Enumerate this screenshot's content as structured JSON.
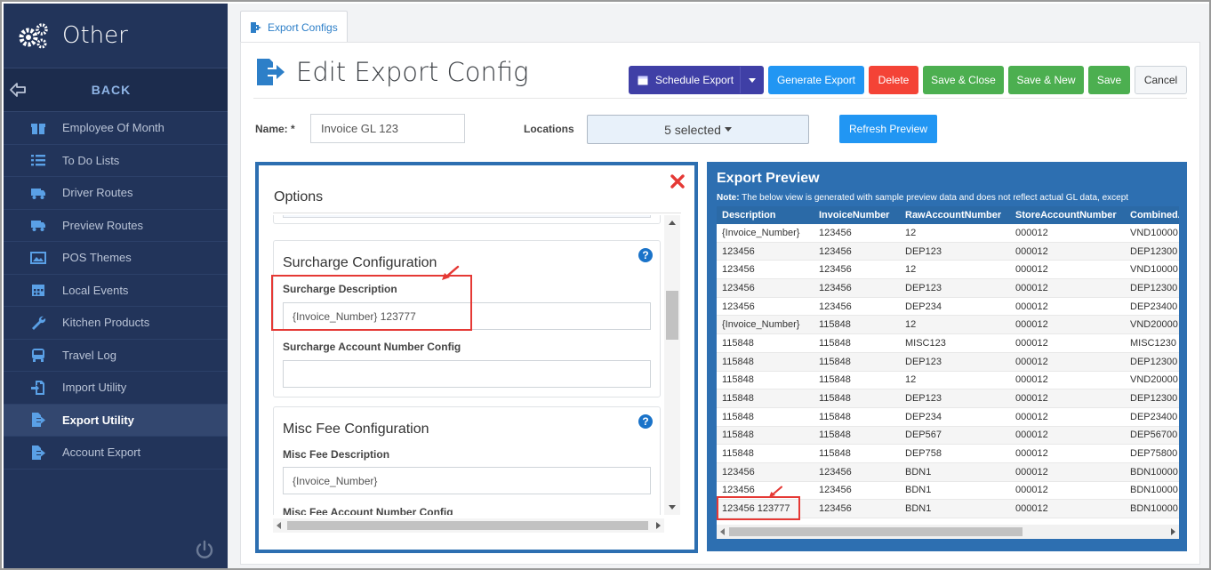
{
  "sidebar": {
    "title": "Other",
    "back_label": "BACK",
    "items": [
      {
        "label": "Employee Of Month",
        "icon": "gift-icon"
      },
      {
        "label": "To Do Lists",
        "icon": "list-icon"
      },
      {
        "label": "Driver Routes",
        "icon": "truck-icon"
      },
      {
        "label": "Preview Routes",
        "icon": "truck-icon"
      },
      {
        "label": "POS Themes",
        "icon": "image-icon"
      },
      {
        "label": "Local Events",
        "icon": "calendar-icon"
      },
      {
        "label": "Kitchen Products",
        "icon": "wrench-icon"
      },
      {
        "label": "Travel Log",
        "icon": "bus-icon"
      },
      {
        "label": "Import Utility",
        "icon": "import-icon"
      },
      {
        "label": "Export Utility",
        "icon": "export-icon",
        "active": true
      },
      {
        "label": "Account Export",
        "icon": "export-icon"
      }
    ]
  },
  "tab": {
    "label": "Export Configs"
  },
  "header": {
    "title": "Edit Export Config",
    "buttons": {
      "schedule": "Schedule Export",
      "generate": "Generate Export",
      "delete": "Delete",
      "save_close": "Save & Close",
      "save_new": "Save & New",
      "save": "Save",
      "cancel": "Cancel"
    }
  },
  "form": {
    "name_label": "Name: *",
    "name_value": "Invoice GL 123",
    "locations_label": "Locations",
    "locations_value": "5 selected",
    "refresh_label": "Refresh Preview"
  },
  "options": {
    "title": "Options",
    "surcharge": {
      "title": "Surcharge Configuration",
      "desc_label": "Surcharge Description",
      "desc_value": "{Invoice_Number} 123777",
      "acct_label": "Surcharge Account Number Config",
      "acct_value": ""
    },
    "misc": {
      "title": "Misc Fee Configuration",
      "desc_label": "Misc Fee Description",
      "desc_value": "{Invoice_Number}",
      "acct_label": "Misc Fee Account Number Config"
    }
  },
  "preview": {
    "title": "Export Preview",
    "note_prefix": "Note:",
    "note_text": " The below view is generated with sample preview data and does not reflect actual GL data, except",
    "columns": [
      "Description",
      "InvoiceNumber",
      "RawAccountNumber",
      "StoreAccountNumber",
      "CombinedA"
    ],
    "rows": [
      [
        "{Invoice_Number}",
        "123456",
        "12",
        "000012",
        "VND10000"
      ],
      [
        "123456",
        "123456",
        "DEP123",
        "000012",
        "DEP12300"
      ],
      [
        "123456",
        "123456",
        "12",
        "000012",
        "VND10000"
      ],
      [
        "123456",
        "123456",
        "DEP123",
        "000012",
        "DEP12300"
      ],
      [
        "123456",
        "123456",
        "DEP234",
        "000012",
        "DEP23400"
      ],
      [
        "{Invoice_Number}",
        "115848",
        "12",
        "000012",
        "VND20000"
      ],
      [
        "115848",
        "115848",
        "MISC123",
        "000012",
        "MISC1230"
      ],
      [
        "115848",
        "115848",
        "DEP123",
        "000012",
        "DEP12300"
      ],
      [
        "115848",
        "115848",
        "12",
        "000012",
        "VND20000"
      ],
      [
        "115848",
        "115848",
        "DEP123",
        "000012",
        "DEP12300"
      ],
      [
        "115848",
        "115848",
        "DEP234",
        "000012",
        "DEP23400"
      ],
      [
        "115848",
        "115848",
        "DEP567",
        "000012",
        "DEP56700"
      ],
      [
        "115848",
        "115848",
        "DEP758",
        "000012",
        "DEP75800"
      ],
      [
        "123456",
        "123456",
        "BDN1",
        "000012",
        "BDN10000"
      ],
      [
        "123456",
        "123456",
        "BDN1",
        "000012",
        "BDN10000"
      ],
      [
        "123456 123777",
        "123456",
        "BDN1",
        "000012",
        "BDN10000"
      ]
    ]
  },
  "colors": {
    "sidebar_bg": "#22345a",
    "accent_blue": "#2196f3",
    "panel_blue": "#2d6fb1",
    "danger": "#f44336",
    "success": "#4caf50",
    "schedule": "#3f3fa6",
    "highlight": "#e53935"
  }
}
